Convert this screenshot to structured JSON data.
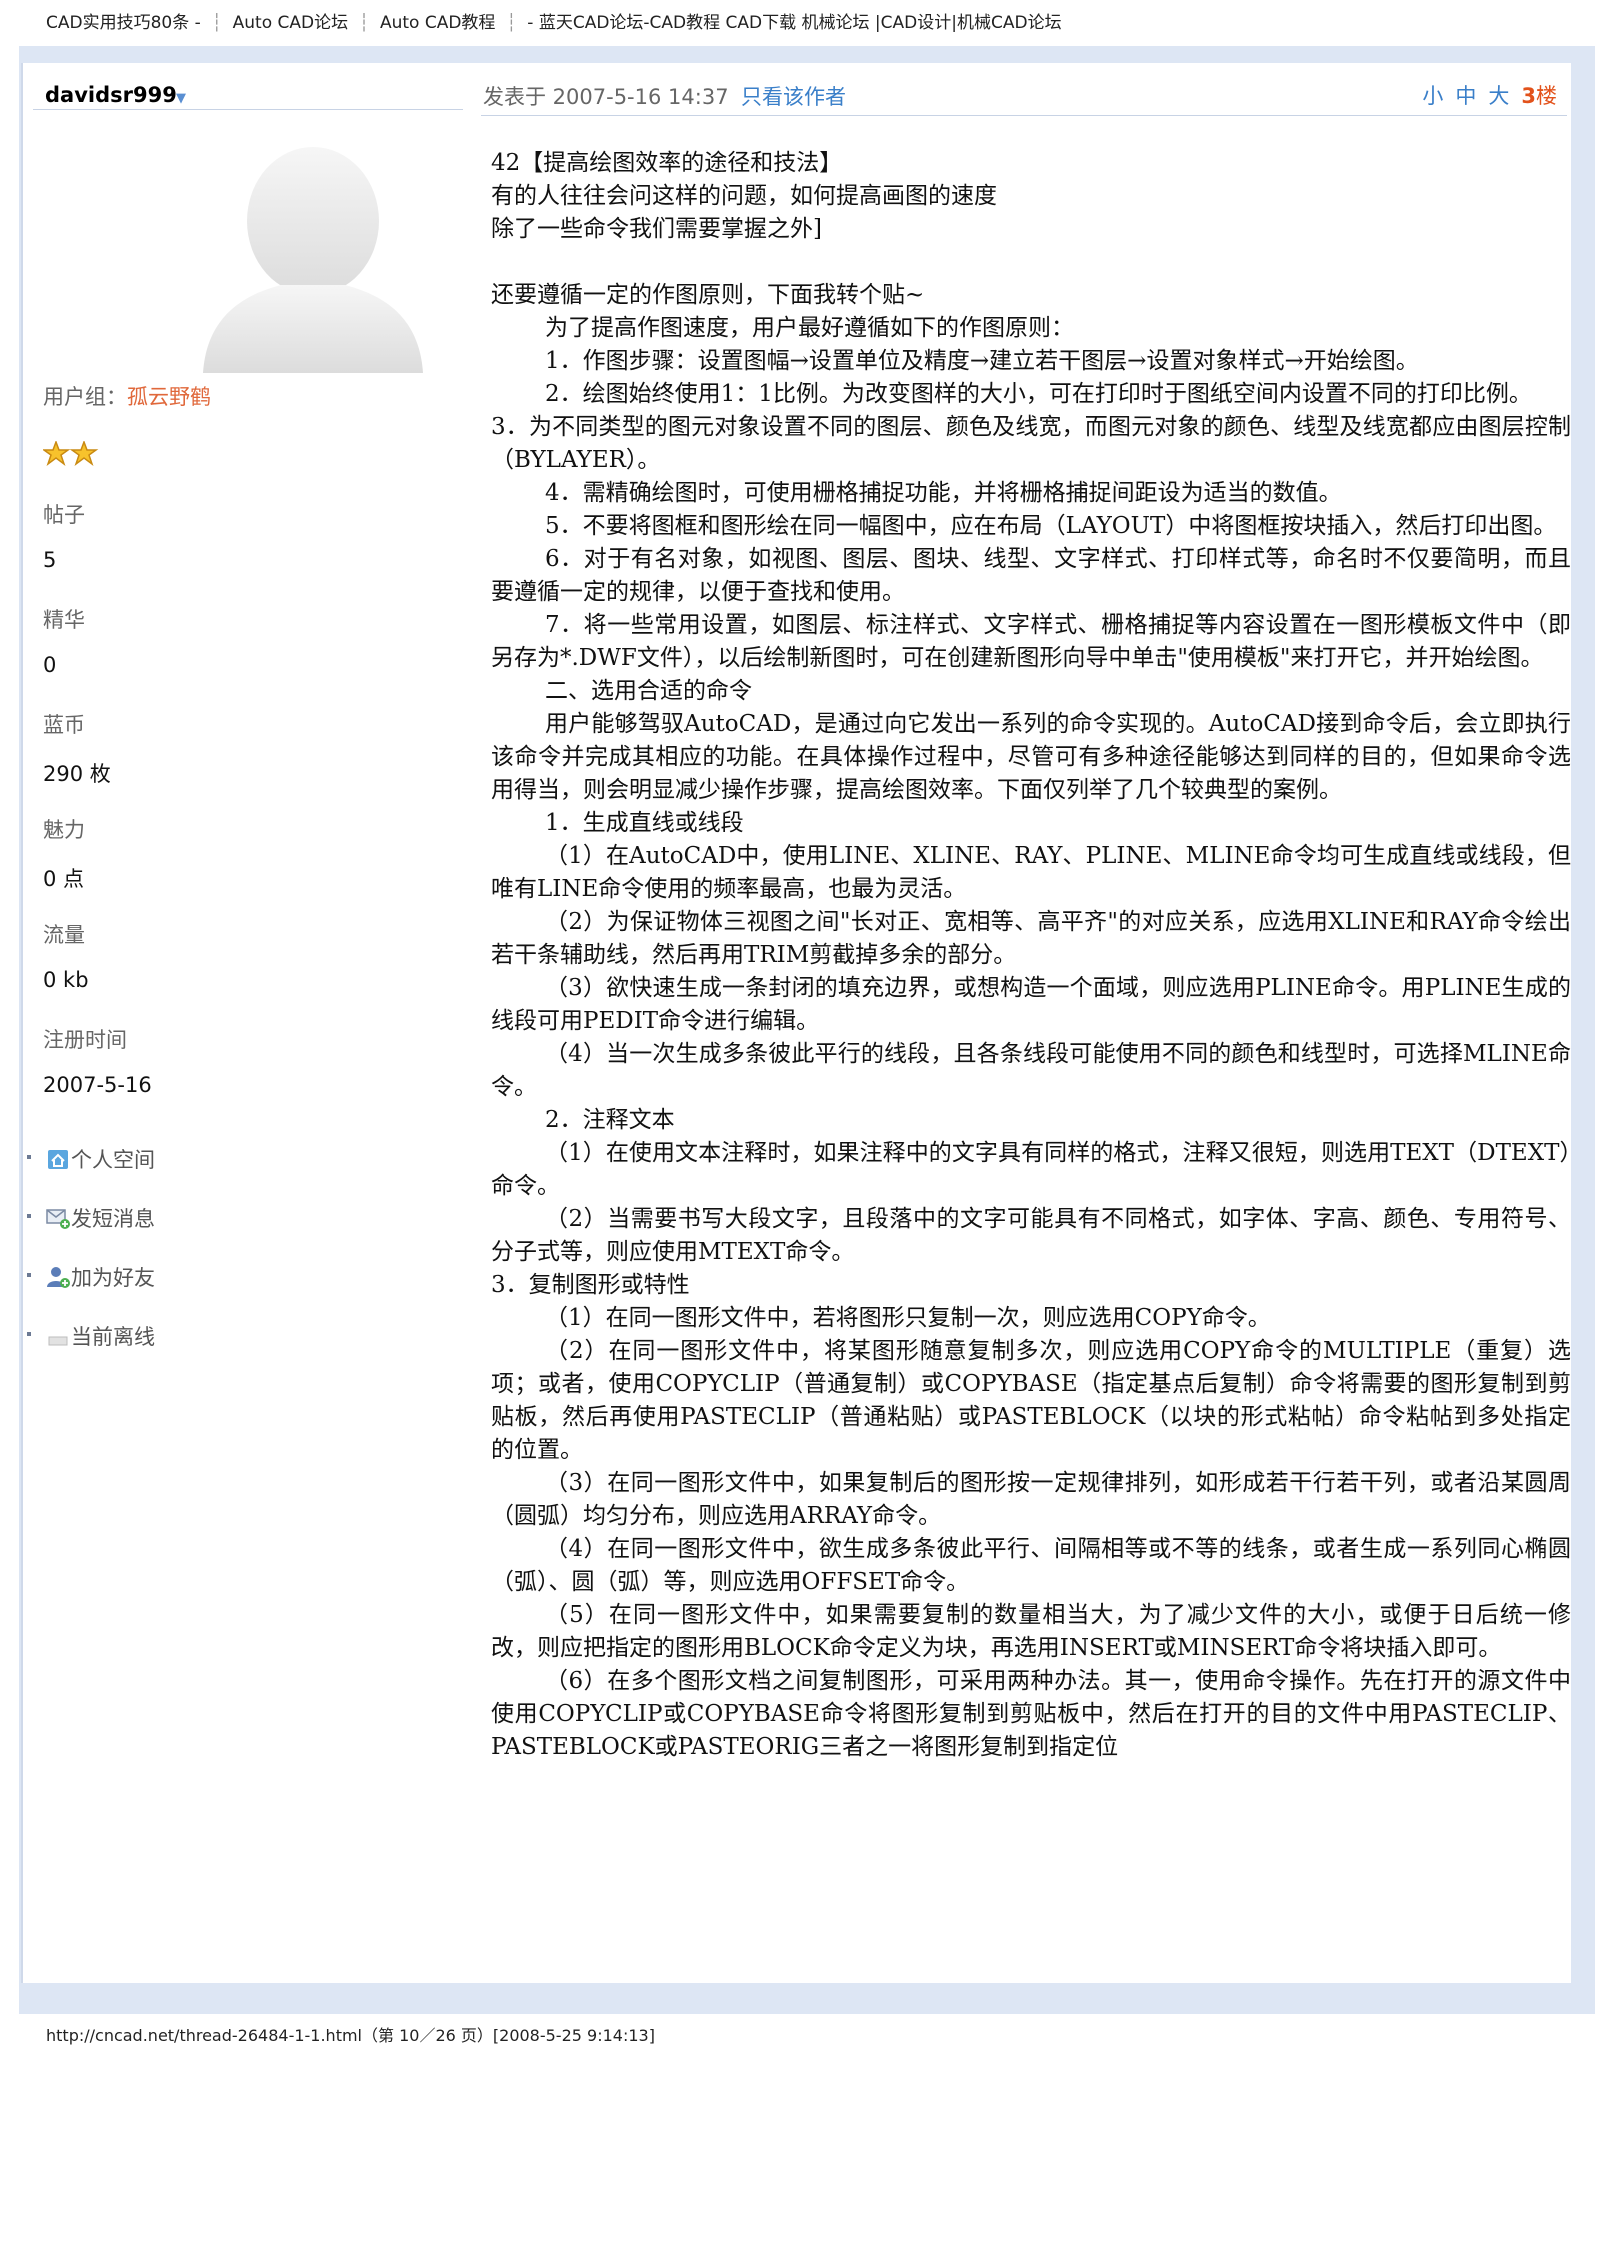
{
  "print_header": {
    "title": "CAD实用技巧80条 -",
    "crumb1": "Auto CAD论坛",
    "crumb2": "Auto CAD教程",
    "site": "- 蓝天CAD论坛-CAD教程 CAD下载 机械论坛 |CAD设计|机械CAD论坛"
  },
  "user": {
    "name": "davidsr999",
    "group_label": "用户组：",
    "group_name": "孤云野鹤",
    "stats": [
      {
        "label": "帖子",
        "value": "5"
      },
      {
        "label": "精华",
        "value": "0"
      },
      {
        "label": "蓝币",
        "value": "290 枚"
      },
      {
        "label": "魅力",
        "value": "0 点"
      },
      {
        "label": "流量",
        "value": "0 kb"
      },
      {
        "label": "注册时间",
        "value": "2007-5-16"
      }
    ],
    "links": [
      "个人空间",
      "发短消息",
      "加为好友",
      "当前离线"
    ]
  },
  "post": {
    "date": "发表于 2007-5-16 14:37",
    "only_author": "只看该作者",
    "font_small": "小",
    "font_medium": "中",
    "font_large": "大",
    "floor_number": "3",
    "floor_unit": "楼",
    "paragraphs": [
      "42【提高绘图效率的途径和技法】",
      "有的人往往会问这样的问题，如何提高画图的速度",
      "除了一些命令我们需要掌握之外]",
      "",
      "还要遵循一定的作图原则，下面我转个贴~",
      "为了提高作图速度，用户最好遵循如下的作图原则：",
      "1．作图步骤：设置图幅→设置单位及精度→建立若干图层→设置对象样式→开始绘图。",
      "2．绘图始终使用1：1比例。为改变图样的大小，可在打印时于图纸空间内设置不同的打印比例。",
      "3．为不同类型的图元对象设置不同的图层、颜色及线宽，而图元对象的颜色、线型及线宽都应由图层控制（BYLAYER）。",
      "4．需精确绘图时，可使用栅格捕捉功能，并将栅格捕捉间距设为适当的数值。",
      "5．不要将图框和图形绘在同一幅图中，应在布局（LAYOUT）中将图框按块插入，然后打印出图。",
      "6．对于有名对象，如视图、图层、图块、线型、文字样式、打印样式等，命名时不仅要简明，而且要遵循一定的规律，以便于查找和使用。",
      "7．将一些常用设置，如图层、标注样式、文字样式、栅格捕捉等内容设置在一图形模板文件中（即另存为*.DWF文件），以后绘制新图时，可在创建新图形向导中单击\"使用模板\"来打开它，并开始绘图。",
      "二、选用合适的命令",
      "用户能够驾驭AutoCAD，是通过向它发出一系列的命令实现的。AutoCAD接到命令后，会立即执行该命令并完成其相应的功能。在具体操作过程中，尽管可有多种途径能够达到同样的目的，但如果命令选用得当，则会明显减少操作步骤，提高绘图效率。下面仅列举了几个较典型的案例。",
      "1．生成直线或线段",
      "（1）在AutoCAD中，使用LINE、XLINE、RAY、PLINE、MLINE命令均可生成直线或线段，但唯有LINE命令使用的频率最高，也最为灵活。",
      "（2）为保证物体三视图之间\"长对正、宽相等、高平齐\"的对应关系，应选用XLINE和RAY命令绘出若干条辅助线，然后再用TRIM剪截掉多余的部分。",
      "（3）欲快速生成一条封闭的填充边界，或想构造一个面域，则应选用PLINE命令。用PLINE生成的线段可用PEDIT命令进行编辑。",
      "（4）当一次生成多条彼此平行的线段，且各条线段可能使用不同的颜色和线型时，可选择MLINE命令。",
      "2．注释文本",
      "（1）在使用文本注释时，如果注释中的文字具有同样的格式，注释又很短，则选用TEXT（DTEXT）命令。",
      "（2）当需要书写大段文字，且段落中的文字可能具有不同格式，如字体、字高、颜色、专用符号、分子式等，则应使用MTEXT命令。",
      "3．复制图形或特性",
      "（1）在同一图形文件中，若将图形只复制一次，则应选用COPY命令。",
      "（2）在同一图形文件中，将某图形随意复制多次，则应选用COPY命令的MULTIPLE（重复）选项；或者，使用COPYCLIP（普通复制）或COPYBASE（指定基点后复制）命令将需要的图形复制到剪贴板，然后再使用PASTECLIP（普通粘贴）或PASTEBLOCK（以块的形式粘帖）命令粘帖到多处指定的位置。",
      "（3）在同一图形文件中，如果复制后的图形按一定规律排列，如形成若干行若干列，或者沿某圆周（圆弧）均匀分布，则应选用ARRAY命令。",
      "（4）在同一图形文件中，欲生成多条彼此平行、间隔相等或不等的线条，或者生成一系列同心椭圆（弧）、圆（弧）等，则应选用OFFSET命令。",
      "（5）在同一图形文件中，如果需要复制的数量相当大，为了减少文件的大小，或便于日后统一修改，则应把指定的图形用BLOCK命令定义为块，再选用INSERT或MINSERT命令将块插入即可。",
      "（6）在多个图形文档之间复制图形，可采用两种办法。其一，使用命令操作。先在打开的源文件中使用COPYCLIP或COPYBASE命令将图形复制到剪贴板中，然后在打开的目的文件中用PASTECLIP、PASTEBLOCK或PASTEORIG三者之一将图形复制到指定位"
    ]
  },
  "print_footer": "http://cncad.net/thread-26484-1-1.html（第 10／26 页）[2008-5-25 9:14:13]",
  "colors": {
    "frame": "#dde6f4",
    "link": "#3a7fc9",
    "floor": "#e2521b",
    "group": "#e0683b"
  }
}
